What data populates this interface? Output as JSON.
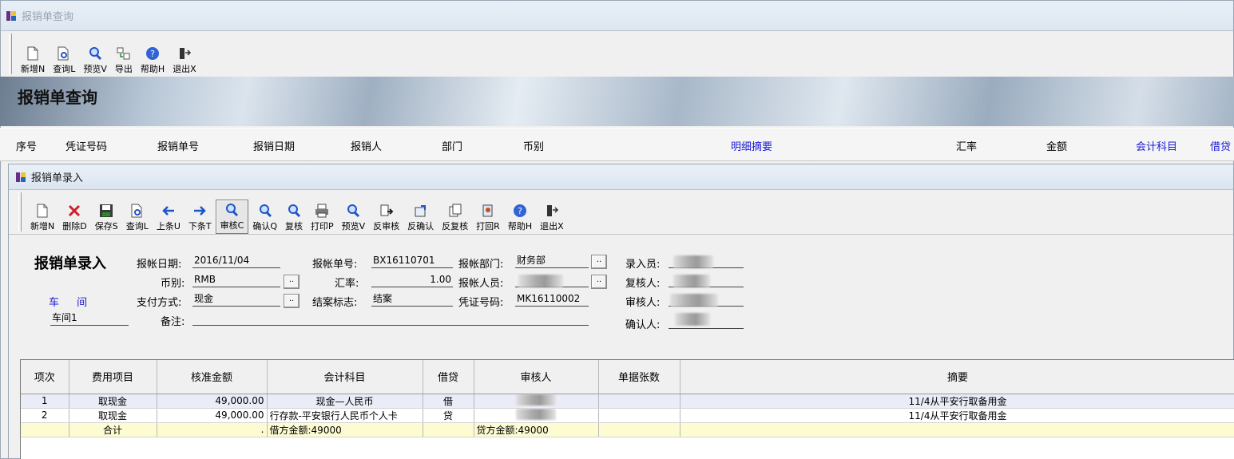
{
  "outer": {
    "title": "报销单查询",
    "toolbar": [
      {
        "label": "新增N",
        "icon": "new-doc-icon"
      },
      {
        "label": "查询L",
        "icon": "query-doc-icon"
      },
      {
        "label": "预览V",
        "icon": "magnifier-icon"
      },
      {
        "label": "导出",
        "icon": "export-icon"
      },
      {
        "label": "帮助H",
        "icon": "help-icon"
      },
      {
        "label": "退出X",
        "icon": "exit-door-icon"
      }
    ],
    "banner_title": "报销单查询",
    "columns": [
      "序号",
      "凭证号码",
      "报销单号",
      "报销日期",
      "报销人",
      "部门",
      "币别",
      "明细摘要",
      "汇率",
      "金额",
      "会计科目",
      "借贷"
    ]
  },
  "child": {
    "title": "报销单录入",
    "toolbar": [
      {
        "label": "新增N",
        "icon": "new-doc-icon"
      },
      {
        "label": "删除D",
        "icon": "delete-x-icon"
      },
      {
        "label": "保存S",
        "icon": "save-disk-icon"
      },
      {
        "label": "查询L",
        "icon": "query-doc-icon"
      },
      {
        "label": "上条U",
        "icon": "arrow-left-icon"
      },
      {
        "label": "下条T",
        "icon": "arrow-right-icon"
      },
      {
        "label": "审核C",
        "icon": "magnifier-icon"
      },
      {
        "label": "确认Q",
        "icon": "magnifier-icon"
      },
      {
        "label": "复核",
        "icon": "magnifier-icon"
      },
      {
        "label": "打印P",
        "icon": "printer-icon"
      },
      {
        "label": "预览V",
        "icon": "magnifier-icon"
      },
      {
        "label": "反审核",
        "icon": "undo-audit-icon"
      },
      {
        "label": "反确认",
        "icon": "undo-confirm-icon"
      },
      {
        "label": "反复核",
        "icon": "undo-review-icon"
      },
      {
        "label": "打回R",
        "icon": "return-icon"
      },
      {
        "label": "帮助H",
        "icon": "help-icon"
      },
      {
        "label": "退出X",
        "icon": "exit-door-icon"
      }
    ],
    "form": {
      "heading": "报销单录入",
      "report_date_label": "报帐日期:",
      "report_date": "2016/11/04",
      "report_no_label": "报帐单号:",
      "report_no": "BX16110701",
      "dept_label": "报帐部门:",
      "dept": "财务部",
      "entry_label": "录入员:",
      "currency_label": "币别:",
      "currency": "RMB",
      "rate_label": "汇率:",
      "rate": "1.00",
      "person_label": "报帐人员:",
      "reviewer_label": "复核人:",
      "workshop_label": "车 间",
      "workshop": "车间1",
      "pay_method_label": "支付方式:",
      "pay_method": "现金",
      "close_label": "结案标志:",
      "close_flag": "结案",
      "voucher_label": "凭证号码:",
      "voucher": "MK16110002",
      "auditor_label": "审核人:",
      "remark_label": "备注:",
      "confirmer_label": "确认人:",
      "dots": ".."
    },
    "grid": {
      "headers": [
        "项次",
        "费用项目",
        "核准金额",
        "会计科目",
        "借贷",
        "审核人",
        "单据张数",
        "摘要"
      ],
      "rows": [
        {
          "no": "1",
          "item": "取现金",
          "amount": "49,000.00",
          "account": "现金—人民币",
          "dc": "借",
          "summary": "11/4从平安行取备用金"
        },
        {
          "no": "2",
          "item": "取现金",
          "amount": "49,000.00",
          "account": "行存款-平安银行人民币个人卡",
          "dc": "贷",
          "summary": "11/4从平安行取备用金"
        }
      ],
      "total": {
        "label": "合计",
        "amount": ".",
        "debit": "借方金额:49000",
        "credit": "贷方金额:49000"
      }
    }
  }
}
